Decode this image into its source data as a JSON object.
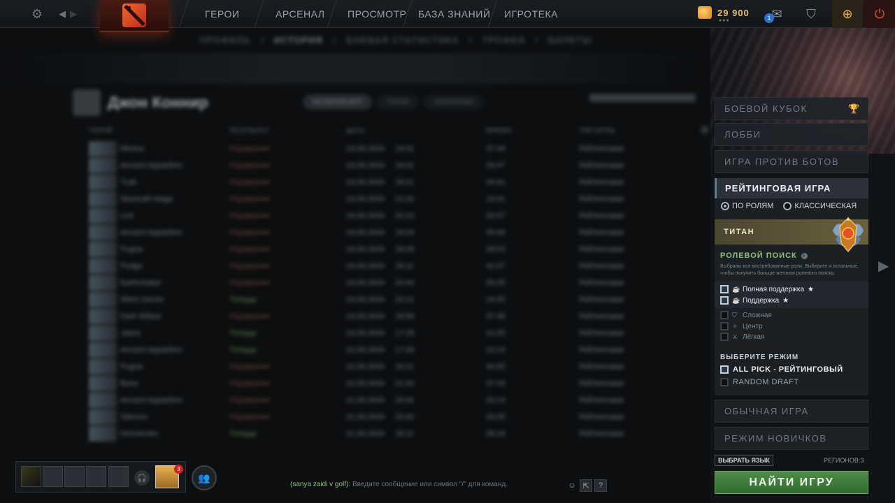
{
  "nav": {
    "items": [
      {
        "label": "ГЕРОИ",
        "name": "nav-heroes"
      },
      {
        "label": "АРСЕНАЛ",
        "name": "nav-arsenal"
      },
      {
        "label": "ПРОСМОТР",
        "name": "nav-watch"
      },
      {
        "label": "БАЗА ЗНАНИЙ",
        "name": "nav-knowledge-base"
      },
      {
        "label": "ИГРОТЕКА",
        "name": "nav-arcade"
      }
    ],
    "gold": "29 900",
    "messages_badge": "1"
  },
  "profile": {
    "subnav": [
      {
        "label": "ПРОФИЛЬ"
      },
      {
        "label": "ИСТОРИЯ"
      },
      {
        "label": "БОЕВАЯ СТАТИСТИКА"
      },
      {
        "label": "ТРОФЕИ"
      },
      {
        "label": "БИЛЕТЫ"
      }
    ],
    "player_name": "Джон Коннир",
    "tabs": [
      "ИСТОРИЯ ИГР",
      "ГЕРОИ",
      "СОЮЗНИКИ"
    ],
    "match_columns": [
      "ГЕРОЙ",
      "РЕЗУЛЬТАТ",
      "ДАТА",
      "ВРЕМЯ",
      "ТИП ИГРЫ"
    ],
    "matches": [
      {
        "hero": "Mirana",
        "result": "Поражение",
        "date": "23.09.2024",
        "time": "19:41",
        "duration": "37:34",
        "type": "Рейтинговая"
      },
      {
        "hero": "Ancient Apparition",
        "result": "Поражение",
        "date": "23.09.2024",
        "time": "19:01",
        "duration": "29:47",
        "type": "Рейтинговая"
      },
      {
        "hero": "Tusk",
        "result": "Поражение",
        "date": "23.09.2024",
        "time": "18:21",
        "duration": "34:41",
        "type": "Рейтинговая"
      },
      {
        "hero": "Skywrath Mage",
        "result": "Поражение",
        "date": "23.09.2024",
        "time": "21:02",
        "duration": "15:01",
        "type": "Рейтинговая"
      },
      {
        "hero": "Lich",
        "result": "Поражение",
        "date": "24.09.2024",
        "time": "20:23",
        "duration": "32:57",
        "type": "Рейтинговая"
      },
      {
        "hero": "Ancient Apparition",
        "result": "Поражение",
        "date": "24.09.2024",
        "time": "19:24",
        "duration": "45:44",
        "type": "Рейтинговая"
      },
      {
        "hero": "Pugna",
        "result": "Поражение",
        "date": "24.09.2024",
        "time": "18:29",
        "duration": "28:53",
        "type": "Рейтинговая"
      },
      {
        "hero": "Pudge",
        "result": "Поражение",
        "date": "24.09.2024",
        "time": "18:11",
        "duration": "41:07",
        "type": "Рейтинговая"
      },
      {
        "hero": "Earthshaker",
        "result": "Поражение",
        "date": "23.09.2024",
        "time": "20:44",
        "duration": "35:35",
        "type": "Рейтинговая"
      },
      {
        "hero": "Witch Doctor",
        "result": "Победа",
        "date": "23.09.2024",
        "time": "20:12",
        "duration": "24:45",
        "type": "Рейтинговая"
      },
      {
        "hero": "Dark Willow",
        "result": "Поражение",
        "date": "23.09.2024",
        "time": "18:56",
        "duration": "37:38",
        "type": "Рейтинговая"
      },
      {
        "hero": "Jakiro",
        "result": "Победа",
        "date": "23.09.2024",
        "time": "17:28",
        "duration": "31:55",
        "type": "Рейтинговая"
      },
      {
        "hero": "Ancient Apparition",
        "result": "Победа",
        "date": "22.09.2024",
        "time": "17:26",
        "duration": "22:14",
        "type": "Рейтинговая"
      },
      {
        "hero": "Pugna",
        "result": "Поражение",
        "date": "22.09.2024",
        "time": "16:21",
        "duration": "40:05",
        "type": "Рейтинговая"
      },
      {
        "hero": "Bane",
        "result": "Поражение",
        "date": "22.09.2024",
        "time": "21:44",
        "duration": "37:24",
        "type": "Рейтинговая"
      },
      {
        "hero": "Ancient Apparition",
        "result": "Поражение",
        "date": "21.09.2024",
        "time": "20:42",
        "duration": "32:14",
        "type": "Рейтинговая"
      },
      {
        "hero": "Silencer",
        "result": "Поражение",
        "date": "21.09.2024",
        "time": "20:02",
        "duration": "33:35",
        "type": "Рейтинговая"
      },
      {
        "hero": "Grimstroke",
        "result": "Победа",
        "date": "21.09.2024",
        "time": "18:11",
        "duration": "38:24",
        "type": "Рейтинговая"
      }
    ]
  },
  "play": {
    "modes": [
      {
        "label": "БОЕВОЙ КУБОК",
        "name": "battle-cup-button"
      },
      {
        "label": "ЛОББИ",
        "name": "lobby-button"
      },
      {
        "label": "ИГРА ПРОТИВ БОТОВ",
        "name": "bot-match-button"
      }
    ],
    "ranked_title": "РЕЙТИНГОВАЯ ИГРА",
    "queue_roles": "ПО РОЛЯМ",
    "queue_classic": "КЛАССИЧЕСКАЯ",
    "rank_tier": "ТИТАН",
    "role_search_title": "РОЛЕВОЙ ПОИСК",
    "role_search_desc": "Выбраны все востребованные роли. Выберите и остальные, чтобы получить больше жетонов ролевого поиска.",
    "roles": [
      {
        "label": "Полная поддержка",
        "checked": true,
        "star": "★"
      },
      {
        "label": "Поддержка",
        "checked": true,
        "star": "★"
      },
      {
        "label": "Сложная",
        "checked": false,
        "star": ""
      },
      {
        "label": "Центр",
        "checked": false,
        "star": ""
      },
      {
        "label": "Лёгкая",
        "checked": false,
        "star": ""
      }
    ],
    "mode_select_title": "ВЫБЕРИТЕ РЕЖИМ",
    "game_modes": [
      {
        "label": "ALL PICK - РЕЙТИНГОВЫЙ",
        "checked": true
      },
      {
        "label": "RANDOM DRAFT",
        "checked": false
      }
    ],
    "normal_game": "ОБЫЧНАЯ ИГРА",
    "new_player_mode": "РЕЖИМ НОВИЧКОВ",
    "language_button": "ВЫБРАТЬ ЯЗЫК",
    "regions": "РЕГИОНОВ:3",
    "find_match": "НАЙТИ ИГРУ"
  },
  "chat": {
    "channel": "(sanya zaidi v golf):",
    "placeholder": "Введите сообщение или символ \"/\" для команд."
  },
  "party": {
    "notification_badge": "3"
  }
}
